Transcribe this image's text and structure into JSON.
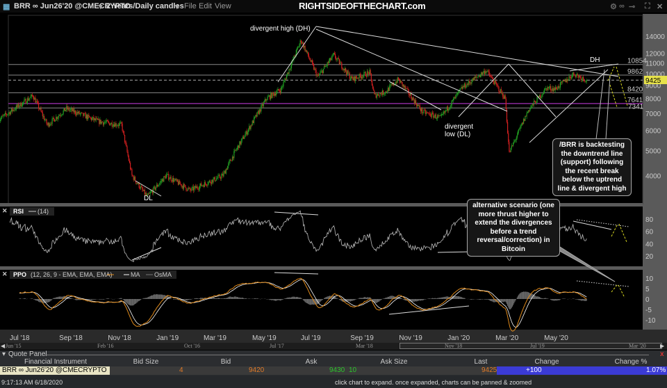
{
  "toolbar": {
    "symbol": "BRR ∞ Jun26'20 @CMECRYPTO",
    "timeframe": "2 Years/Daily candles",
    "menu": [
      "File",
      "Edit",
      "View"
    ],
    "brand": "RIGHTSIDEOFTHECHART.com"
  },
  "chart_data": [
    {
      "type": "candlestick",
      "title": "",
      "scale": "log",
      "ylim": [
        3200,
        15500
      ],
      "yticks": [
        4000,
        5000,
        6000,
        7000,
        8000,
        9000,
        10000,
        11000,
        12000,
        14000
      ],
      "xticks": [
        "Jul '18",
        "Sep '18",
        "Nov '18",
        "Jan '19",
        "Mar '19",
        "May '19",
        "Jul '19",
        "Sep '19",
        "Nov '19",
        "Jan '20",
        "Mar '20",
        "May '20"
      ],
      "close_keypoints": [
        [
          "2018-06-12",
          6600
        ],
        [
          "2018-07-25",
          8200
        ],
        [
          "2018-08-12",
          6300
        ],
        [
          "2018-09-05",
          7300
        ],
        [
          "2018-10-15",
          6500
        ],
        [
          "2018-11-13",
          6300
        ],
        [
          "2018-11-26",
          4000
        ],
        [
          "2018-12-15",
          3300
        ],
        [
          "2019-01-08",
          4000
        ],
        [
          "2019-02-07",
          3500
        ],
        [
          "2019-03-20",
          4000
        ],
        [
          "2019-04-05",
          5000
        ],
        [
          "2019-05-14",
          8000
        ],
        [
          "2019-06-01",
          8700
        ],
        [
          "2019-06-26",
          13500
        ],
        [
          "2019-07-17",
          9700
        ],
        [
          "2019-08-06",
          11800
        ],
        [
          "2019-08-29",
          9500
        ],
        [
          "2019-09-20",
          10100
        ],
        [
          "2019-09-26",
          8200
        ],
        [
          "2019-10-10",
          8500
        ],
        [
          "2019-10-26",
          9500
        ],
        [
          "2019-11-25",
          7100
        ],
        [
          "2019-12-18",
          6700
        ],
        [
          "2020-01-14",
          8800
        ],
        [
          "2020-02-13",
          10300
        ],
        [
          "2020-03-08",
          8000
        ],
        [
          "2020-03-13",
          4900
        ],
        [
          "2020-04-06",
          7200
        ],
        [
          "2020-04-29",
          8800
        ],
        [
          "2020-05-10",
          8700
        ],
        [
          "2020-06-02",
          10000
        ],
        [
          "2020-06-18",
          9425
        ]
      ],
      "levels": [
        10854,
        9862,
        8420,
        7641,
        7341
      ],
      "last_price": 9425,
      "annotations": [
        "divergent high (DH)",
        "DL",
        "divergent\nlow (DL)",
        "DH"
      ]
    },
    {
      "type": "line",
      "title": "RSI",
      "params": "(14)",
      "yticks": [
        20,
        40,
        60,
        80
      ]
    },
    {
      "type": "line",
      "title": "PPO",
      "params": "(12, 26, 9 - EMA, EMA, EMA)",
      "series": [
        {
          "name": "",
          "color": "#e08a1a"
        },
        {
          "name": "MA",
          "color": "#ffffff"
        },
        {
          "name": "OsMA",
          "color": "#777777"
        }
      ],
      "yticks": [
        -10,
        -5,
        0,
        5,
        10
      ]
    }
  ],
  "callouts": {
    "main": [
      "/BRR is backtesting",
      "the downtrend line",
      "(support) following",
      "the recent break",
      "below the uptrend",
      "line & divergent high"
    ],
    "alt": [
      "alternative scenario (one",
      "more thrust higher to",
      "extend the divergences",
      "before a trend",
      "reversal/correction) in",
      "Bitcoin"
    ]
  },
  "scroller": [
    "Jun '15",
    "Feb '16",
    "Oct '16",
    "Jul '17",
    "Mar '18",
    "Nov '18",
    "Jul '19",
    "Mar '20"
  ],
  "quote_panel": {
    "title": "Quote Panel",
    "headers": [
      "Financial Instrument",
      "Bid Size",
      "Bid",
      "Ask",
      "Ask Size",
      "Last",
      "Change",
      "Change %"
    ],
    "row": {
      "instrument": "BRR ∞ Jun26'20 @CMECRYPTO",
      "bid_size": "4",
      "bid": "9420",
      "ask": "9430",
      "ask_size": "10",
      "last": "9425",
      "change": "+100",
      "change_pct": "1.07%"
    }
  },
  "status": {
    "time": "9:17:13 AM 6/18/2020",
    "hint": "click chart to expand. once expanded, charts can be panned & zoomed"
  },
  "colors": {
    "up": "#22a022",
    "down": "#d42020",
    "bid": "#e07a28",
    "ask": "#2cc42c",
    "change_bg": "#3b3bd6",
    "level_purple": "#8a2a9a",
    "target_yellow": "#d8d820"
  }
}
